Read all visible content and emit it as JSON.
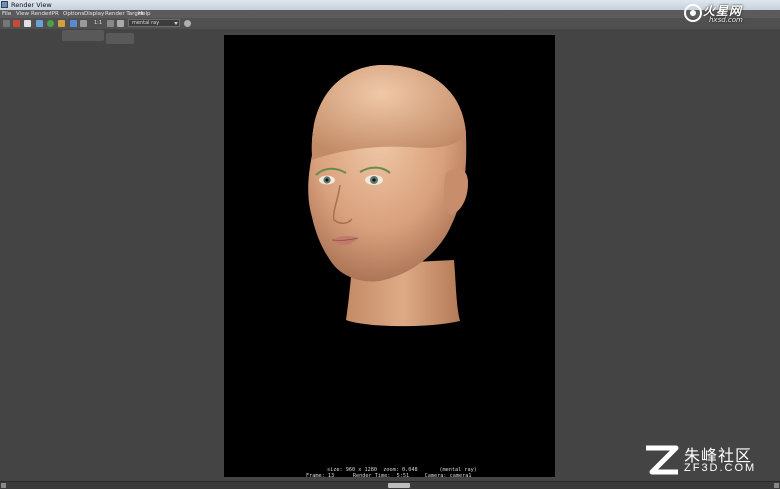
{
  "window": {
    "title": "Render View"
  },
  "menu": {
    "items": [
      "File",
      "View",
      "Render",
      "IPR",
      "Options",
      "Display",
      "Render Target",
      "Help"
    ]
  },
  "toolbar": {
    "buttons": [
      {
        "name": "redo-render-icon",
        "color": "#c94a3a"
      },
      {
        "name": "render-region-icon",
        "color": "#6aa0d8"
      },
      {
        "name": "snapshot-icon",
        "color": "#e0e0e0"
      },
      {
        "name": "ipr-icon",
        "color": "#4aa04a"
      },
      {
        "name": "refresh-icon",
        "color": "#d0a040"
      },
      {
        "name": "color-channel-icon",
        "color": "#5a8ad0"
      }
    ],
    "zoom_label": "1:1",
    "renderer": "mental ray"
  },
  "render_info": {
    "line1": "size: 960 x 1280  zoom: 0.048       (mental ray)",
    "line2": "Frame: 13      Render Time:  5:51     Camera: camera1"
  },
  "watermark_top": {
    "text": "火星网",
    "url": "hxsd.com"
  },
  "watermark_bottom": {
    "text": "朱峰社区",
    "url": "ZF3D.COM"
  },
  "colors": {
    "background": "#444444",
    "render_bg": "#000000",
    "skin": "#d9a07c"
  }
}
